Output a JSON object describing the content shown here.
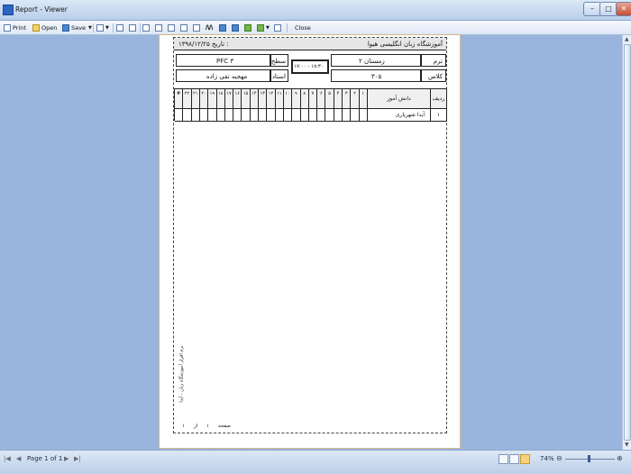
{
  "window": {
    "title": "Report - Viewer"
  },
  "toolbar": {
    "print_label": "Print",
    "open_label": "Open",
    "save_label": "Save",
    "close_label": "Close"
  },
  "report": {
    "school": "آموزشگاه زبان انگلیسی هیوا",
    "date_label": "تاریخ :",
    "date_value": "۱۳۹۸/۱۲/۲۵",
    "term_label": "ترم",
    "term_value": "زمستان ۲",
    "level_label": "سطح",
    "level_value": "PFC ۳",
    "time_value": "۱۷:۰۰ - ۱۸:۳۰",
    "class_label": "کلاس",
    "class_value": "۳۰۵",
    "teacher_label": "استاد",
    "teacher_value": "مهجبه تقی زاده",
    "col_row": "ردیف",
    "col_student": "دانش آموز",
    "session_numbers": [
      "۱",
      "۲",
      "۳",
      "۴",
      "۵",
      "۶",
      "۷",
      "۸",
      "۹",
      "۱۰",
      "۱۱",
      "۱۲",
      "۱۳",
      "۱۴",
      "۱۵",
      "۱۶",
      "۱۷",
      "۱۸",
      "۱۹",
      "۲۰",
      "۲۱",
      "۲۲",
      "#"
    ],
    "rows": [
      {
        "num": "۱",
        "name": "آیدا شهریاری"
      }
    ],
    "side_note": "نرم افزار آموزشگاه زبان - آیدا",
    "footer_page_label": "صفحه",
    "footer_page_num": "۱",
    "footer_of_label": "از",
    "footer_total": "۱"
  },
  "status": {
    "page_info": "Page 1 of 1",
    "zoom": "74%"
  }
}
